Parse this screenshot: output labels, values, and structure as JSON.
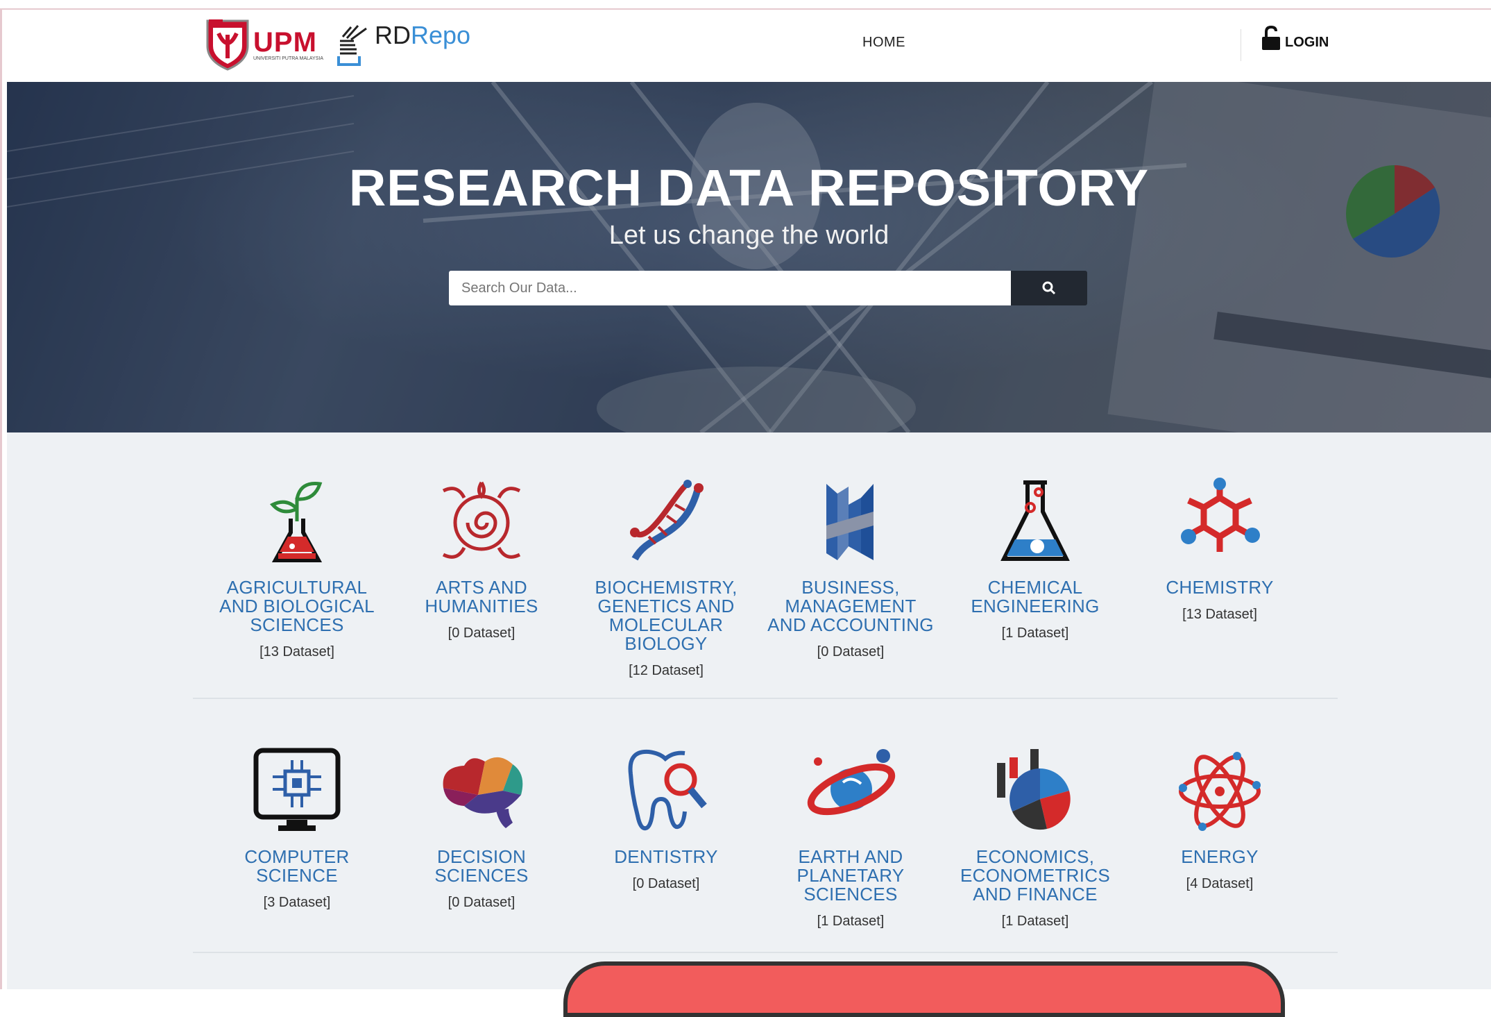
{
  "header": {
    "logo_upm": "UPM",
    "logo_upm_sub": "UNIVERSITI PUTRA MALAYSIA",
    "logo_rd": "RD",
    "logo_repo": "Repo",
    "nav_home": "HOME",
    "login_label": "LOGIN"
  },
  "hero": {
    "title": "RESEARCH DATA REPOSITORY",
    "subtitle": "Let us change the world",
    "search_placeholder": "Search Our Data..."
  },
  "categories": [
    {
      "line1": "AGRICULTURAL",
      "line2": "AND BIOLOGICAL",
      "line3": "SCIENCES",
      "line4": "",
      "count": "[13 Dataset]",
      "icon": "flask-plant-icon"
    },
    {
      "line1": "ARTS AND",
      "line2": "HUMANITIES",
      "line3": "",
      "line4": "",
      "count": "[0 Dataset]",
      "icon": "ornament-icon"
    },
    {
      "line1": "BIOCHEMISTRY,",
      "line2": "GENETICS AND",
      "line3": "MOLECULAR",
      "line4": "BIOLOGY",
      "count": "[12 Dataset]",
      "icon": "dna-icon"
    },
    {
      "line1": "BUSINESS,",
      "line2": "MANAGEMENT",
      "line3": "AND ACCOUNTING",
      "line4": "",
      "count": "[0 Dataset]",
      "icon": "business-blocks-icon"
    },
    {
      "line1": "CHEMICAL",
      "line2": "ENGINEERING",
      "line3": "",
      "line4": "",
      "count": "[1 Dataset]",
      "icon": "flask-gears-icon"
    },
    {
      "line1": "CHEMISTRY",
      "line2": "",
      "line3": "",
      "line4": "",
      "count": "[13 Dataset]",
      "icon": "molecule-icon"
    },
    {
      "line1": "COMPUTER",
      "line2": "SCIENCE",
      "line3": "",
      "line4": "",
      "count": "[3 Dataset]",
      "icon": "computer-chip-icon"
    },
    {
      "line1": "DECISION",
      "line2": "SCIENCES",
      "line3": "",
      "line4": "",
      "count": "[0 Dataset]",
      "icon": "brain-icon"
    },
    {
      "line1": "DENTISTRY",
      "line2": "",
      "line3": "",
      "line4": "",
      "count": "[0 Dataset]",
      "icon": "tooth-icon"
    },
    {
      "line1": "EARTH AND",
      "line2": "PLANETARY",
      "line3": "SCIENCES",
      "line4": "",
      "count": "[1 Dataset]",
      "icon": "planet-icon"
    },
    {
      "line1": "ECONOMICS,",
      "line2": "ECONOMETRICS",
      "line3": "AND FINANCE",
      "line4": "",
      "count": "[1 Dataset]",
      "icon": "pie-bars-icon"
    },
    {
      "line1": "ENERGY",
      "line2": "",
      "line3": "",
      "line4": "",
      "count": "[4 Dataset]",
      "icon": "atom-icon"
    }
  ],
  "colors": {
    "accent_blue": "#2e6fb0",
    "accent_red": "#c8102e",
    "search_button": "#222831",
    "category_bg": "#eef1f4"
  }
}
